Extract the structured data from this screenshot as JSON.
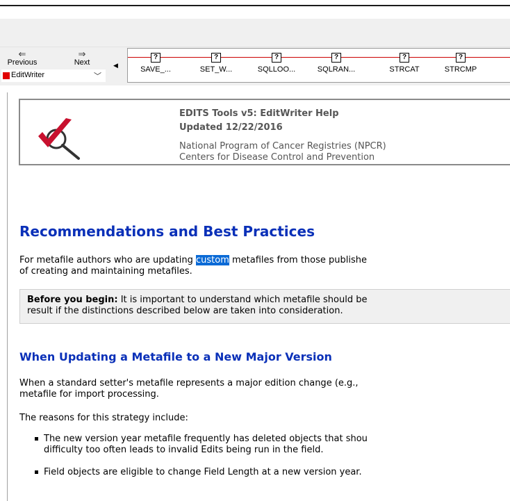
{
  "toolbar": {
    "previous_label": "Previous",
    "next_label": "Next",
    "book_select": "EditWriter"
  },
  "keywords": [
    "SAVE_...",
    "SET_W...",
    "SQLLOO...",
    "SQLRAN...",
    "STRCAT",
    "STRCMP"
  ],
  "header": {
    "title": "EDITS Tools v5: EditWriter Help",
    "updated": "Updated 12/22/2016",
    "org1": "National Program of Cancer Registries (NPCR)",
    "org2": "Centers for Disease Control and Prevention"
  },
  "article": {
    "heading": "Recommendations and Best Practices",
    "intro_before": "For metafile authors who are updating ",
    "intro_highlight": "custom",
    "intro_after": " metafiles from those publishe",
    "intro_line2": "of creating and maintaining metafiles.",
    "note_bold": "Before you begin:",
    "note_text": " It is important to understand which metafile should be",
    "note_line2": "result if the distinctions described below are taken into consideration.",
    "subheading": "When Updating a Metafile to a New Major Version",
    "para1_line1": "When a standard setter's metafile represents a major edition change (e.g.,",
    "para1_line2": "metafile for import processing.",
    "para2": "The reasons for this strategy include:",
    "bullet1_line1": "The new version year metafile frequently has deleted objects that shou",
    "bullet1_line2": "difficulty too often leads to invalid Edits being run in the field.",
    "bullet2": "Field objects are eligible to change Field Length at a new version year."
  },
  "colors": {
    "heading_blue": "#0a30b8",
    "selection": "#0a6ad6",
    "keyword_line": "#cc0000",
    "logo_check": "#c8102e"
  }
}
